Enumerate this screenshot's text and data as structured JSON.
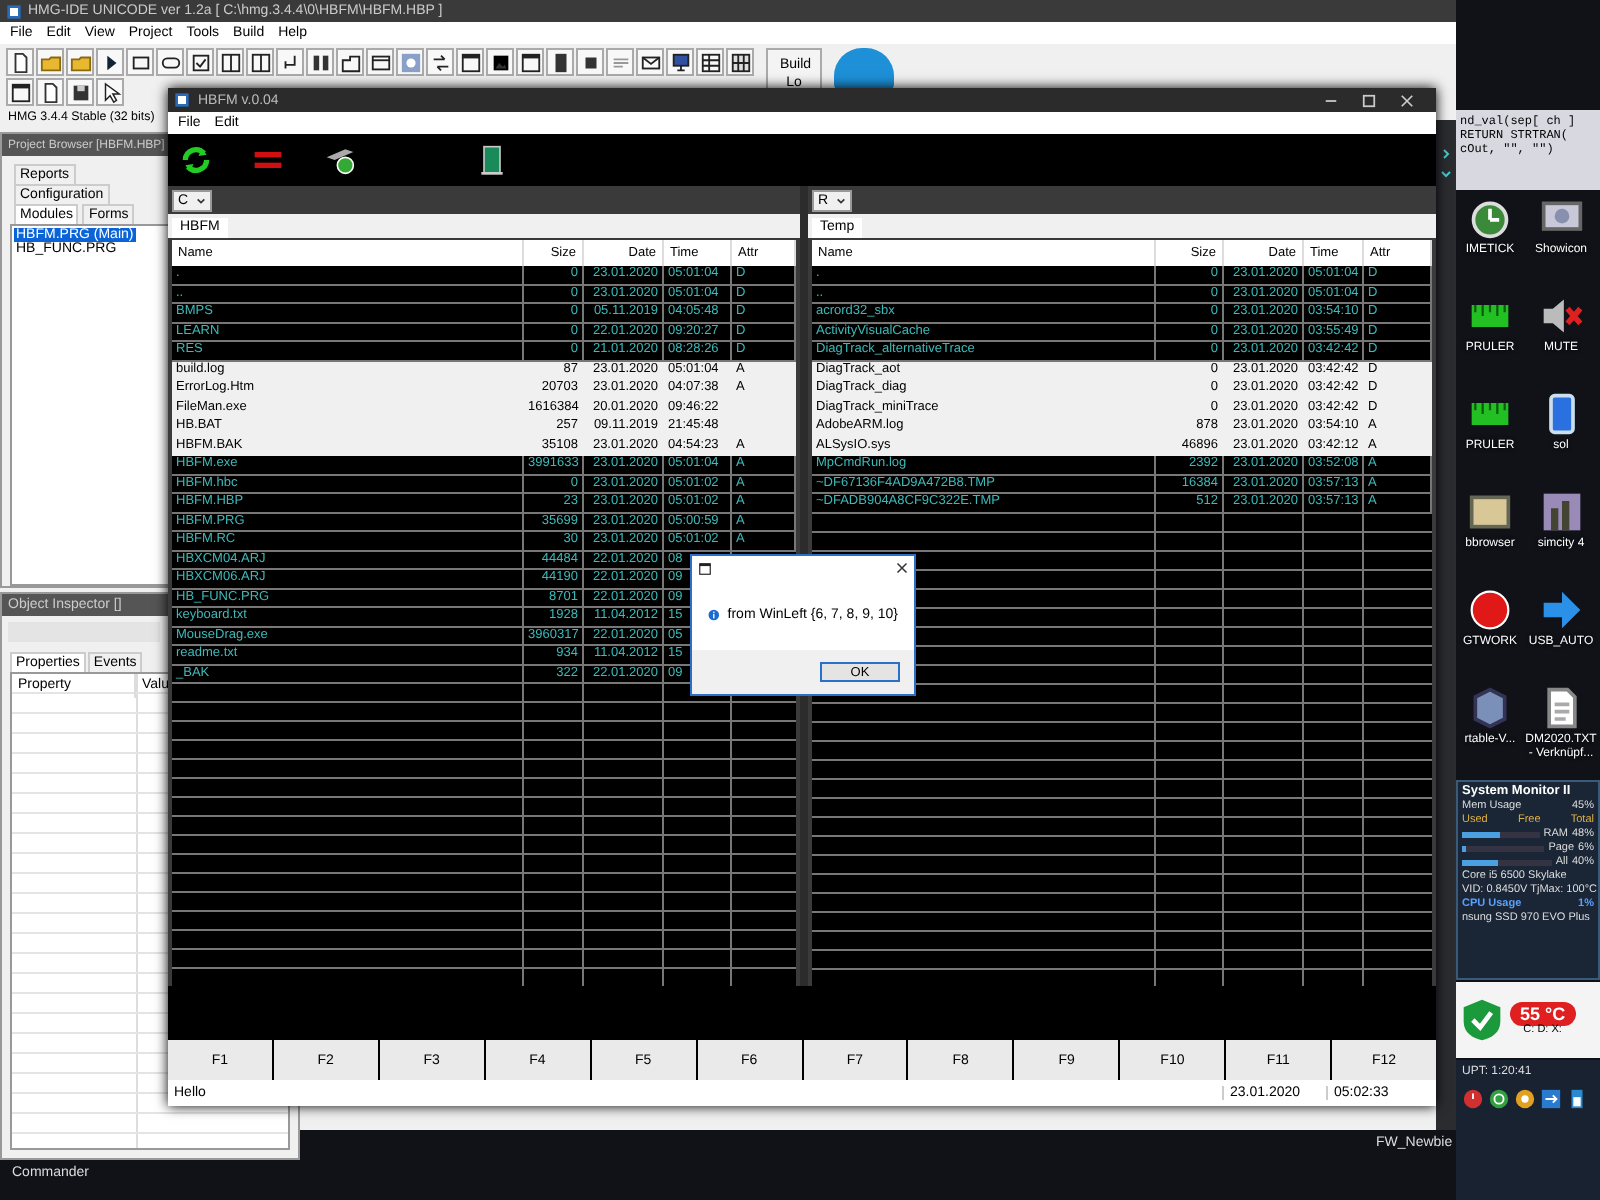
{
  "ide": {
    "title": "HMG-IDE  UNICODE  ver 1.2a  [ C:\\hmg.3.4.4\\0\\HBFM\\HBFM.HBP ]",
    "menu": [
      "File",
      "Edit",
      "View",
      "Project",
      "Tools",
      "Build",
      "Help"
    ],
    "build_button": "Build Lo",
    "status": "HMG 3.4.4 Stable (32 bits)",
    "project_browser": {
      "title": "Project Browser [HBFM.HBP]",
      "tabs": [
        {
          "label": "Reports",
          "selected": false
        },
        {
          "label": "Configuration",
          "selected": false
        },
        {
          "label": "Modules",
          "selected": true
        },
        {
          "label": "Forms",
          "selected": false
        }
      ],
      "modules": [
        {
          "label": "HBFM.PRG (Main)",
          "selected": true
        },
        {
          "label": "HB_FUNC.PRG",
          "selected": false
        }
      ]
    },
    "object_inspector": {
      "title": "Object Inspector []",
      "tabs": [
        {
          "label": "Properties",
          "selected": true
        },
        {
          "label": "Events",
          "selected": false
        }
      ],
      "columns": [
        "Property",
        "Valu"
      ]
    },
    "code_lines": [
      "nd_val(sep[ ch ]",
      "RETURN STRTRAN(",
      "cOut, \"\", \"\")"
    ]
  },
  "hbfm": {
    "title": "HBFM v.0.04",
    "menu": [
      "File",
      "Edit"
    ],
    "panels": [
      {
        "drive": "C",
        "tab": "HBFM",
        "columns": [
          "Name",
          "Size",
          "Date",
          "Time",
          "Attr"
        ],
        "rows": [
          {
            "name": ".",
            "size": "0",
            "date": "23.01.2020",
            "time": "05:01:04",
            "attr": "D",
            "selected": false
          },
          {
            "name": "..",
            "size": "0",
            "date": "23.01.2020",
            "time": "05:01:04",
            "attr": "D",
            "selected": false
          },
          {
            "name": "BMPS",
            "size": "0",
            "date": "05.11.2019",
            "time": "04:05:48",
            "attr": "D",
            "selected": false
          },
          {
            "name": "LEARN",
            "size": "0",
            "date": "22.01.2020",
            "time": "09:20:27",
            "attr": "D",
            "selected": false
          },
          {
            "name": "RES",
            "size": "0",
            "date": "21.01.2020",
            "time": "08:28:26",
            "attr": "D",
            "selected": false
          },
          {
            "name": "build.log",
            "size": "87",
            "date": "23.01.2020",
            "time": "05:01:04",
            "attr": "A",
            "selected": true
          },
          {
            "name": "ErrorLog.Htm",
            "size": "20703",
            "date": "23.01.2020",
            "time": "04:07:38",
            "attr": "A",
            "selected": true
          },
          {
            "name": "FileMan.exe",
            "size": "1616384",
            "date": "20.01.2020",
            "time": "09:46:22",
            "selected": true
          },
          {
            "name": "HB.BAT",
            "size": "257",
            "date": "09.11.2019",
            "time": "21:45:48",
            "selected": true
          },
          {
            "name": "HBFM.BAK",
            "size": "35108",
            "date": "23.01.2020",
            "time": "04:54:23",
            "attr": "A",
            "selected": true
          },
          {
            "name": "HBFM.exe",
            "size": "3991633",
            "date": "23.01.2020",
            "time": "05:01:04",
            "attr": "A",
            "selected": false
          },
          {
            "name": "HBFM.hbc",
            "size": "0",
            "date": "23.01.2020",
            "time": "05:01:02",
            "attr": "A",
            "selected": false
          },
          {
            "name": "HBFM.HBP",
            "size": "23",
            "date": "23.01.2020",
            "time": "05:01:02",
            "attr": "A",
            "selected": false
          },
          {
            "name": "HBFM.PRG",
            "size": "35699",
            "date": "23.01.2020",
            "time": "05:00:59",
            "attr": "A",
            "selected": false
          },
          {
            "name": "HBFM.RC",
            "size": "30",
            "date": "23.01.2020",
            "time": "05:01:02",
            "attr": "A",
            "selected": false
          },
          {
            "name": "HBXCM04.ARJ",
            "size": "44484",
            "date": "22.01.2020",
            "time": "08",
            "selected": false
          },
          {
            "name": "HBXCM06.ARJ",
            "size": "44190",
            "date": "22.01.2020",
            "time": "09",
            "selected": false
          },
          {
            "name": "HB_FUNC.PRG",
            "size": "8701",
            "date": "22.01.2020",
            "time": "09",
            "selected": false
          },
          {
            "name": "keyboard.txt",
            "size": "1928",
            "date": "11.04.2012",
            "time": "15",
            "selected": false
          },
          {
            "name": "MouseDrag.exe",
            "size": "3960317",
            "date": "22.01.2020",
            "time": "05",
            "selected": false
          },
          {
            "name": "readme.txt",
            "size": "934",
            "date": "11.04.2012",
            "time": "15",
            "selected": false
          },
          {
            "name": "_BAK",
            "size": "322",
            "date": "22.01.2020",
            "time": "09",
            "selected": false
          }
        ]
      },
      {
        "drive": "R",
        "tab": "Temp",
        "columns": [
          "Name",
          "Size",
          "Date",
          "Time",
          "Attr"
        ],
        "rows": [
          {
            "name": ".",
            "size": "0",
            "date": "23.01.2020",
            "time": "05:01:04",
            "attr": "D",
            "selected": false
          },
          {
            "name": "..",
            "size": "0",
            "date": "23.01.2020",
            "time": "05:01:04",
            "attr": "D",
            "selected": false
          },
          {
            "name": "acrord32_sbx",
            "size": "0",
            "date": "23.01.2020",
            "time": "03:54:10",
            "attr": "D",
            "selected": false
          },
          {
            "name": "ActivityVisualCache",
            "size": "0",
            "date": "23.01.2020",
            "time": "03:55:49",
            "attr": "D",
            "selected": false
          },
          {
            "name": "DiagTrack_alternativeTrace",
            "size": "0",
            "date": "23.01.2020",
            "time": "03:42:42",
            "attr": "D",
            "selected": false
          },
          {
            "name": "DiagTrack_aot",
            "size": "0",
            "date": "23.01.2020",
            "time": "03:42:42",
            "attr": "D",
            "selected": true
          },
          {
            "name": "DiagTrack_diag",
            "size": "0",
            "date": "23.01.2020",
            "time": "03:42:42",
            "attr": "D",
            "selected": true
          },
          {
            "name": "DiagTrack_miniTrace",
            "size": "0",
            "date": "23.01.2020",
            "time": "03:42:42",
            "attr": "D",
            "selected": true
          },
          {
            "name": "AdobeARM.log",
            "size": "878",
            "date": "23.01.2020",
            "time": "03:54:10",
            "attr": "A",
            "selected": true
          },
          {
            "name": "ALSysIO.sys",
            "size": "46896",
            "date": "23.01.2020",
            "time": "03:42:12",
            "attr": "A",
            "selected": true
          },
          {
            "name": "MpCmdRun.log",
            "size": "2392",
            "date": "23.01.2020",
            "time": "03:52:08",
            "attr": "A",
            "selected": false
          },
          {
            "name": "~DF67136F4AD9A472B8.TMP",
            "size": "16384",
            "date": "23.01.2020",
            "time": "03:57:13",
            "attr": "A",
            "selected": false
          },
          {
            "name": "~DFADB904A8CF9C322E.TMP",
            "size": "512",
            "date": "23.01.2020",
            "time": "03:57:13",
            "attr": "A",
            "selected": false
          }
        ]
      }
    ],
    "function_keys": [
      "F1",
      "F2",
      "F3",
      "F4",
      "F5",
      "F6",
      "F7",
      "F8",
      "F9",
      "F10",
      "F11",
      "F12"
    ],
    "status": {
      "message": "Hello",
      "date": "23.01.2020",
      "time": "05:02:33"
    }
  },
  "dialog": {
    "message": "from WinLeft {6, 7, 8, 9, 10}",
    "button": "OK"
  },
  "desktop": {
    "icons": [
      {
        "label": "IMETICK"
      },
      {
        "label": "Showicon"
      },
      {
        "label": "PRULER"
      },
      {
        "label": "MUTE"
      },
      {
        "label": "PRULER"
      },
      {
        "label": "sol"
      },
      {
        "label": "bbrowser"
      },
      {
        "label": "simcity 4"
      },
      {
        "label": "GTWORK"
      },
      {
        "label": "USB_AUTO"
      },
      {
        "label": "rtable-V..."
      },
      {
        "label": "DM2020.TXT - Verknüpf..."
      }
    ],
    "system_monitor": {
      "title": "System Monitor II",
      "mem_label": "Mem Usage",
      "mem_value": "45%",
      "columns": [
        "Used",
        "Free",
        "Total"
      ],
      "meters": [
        {
          "label": "RAM",
          "value": "48%",
          "level": 0.48
        },
        {
          "label": "Page",
          "value": "6%",
          "level": 0.06
        },
        {
          "label": "All",
          "value": "40%",
          "level": 0.4
        }
      ],
      "cpu_lines": [
        "Core i5 6500 Skylake",
        "VID: 0.8450V TjMax: 100°C"
      ],
      "cpu_label": "CPU Usage",
      "cpu_value": "1%",
      "disk": "nsung SSD 970 EVO Plus"
    },
    "temperature": {
      "value": "55 °C",
      "drives": "C: D: X:"
    },
    "uptime": "UPT: 1:20:41",
    "labels": [
      "Commander",
      "FW_Newbie"
    ]
  }
}
